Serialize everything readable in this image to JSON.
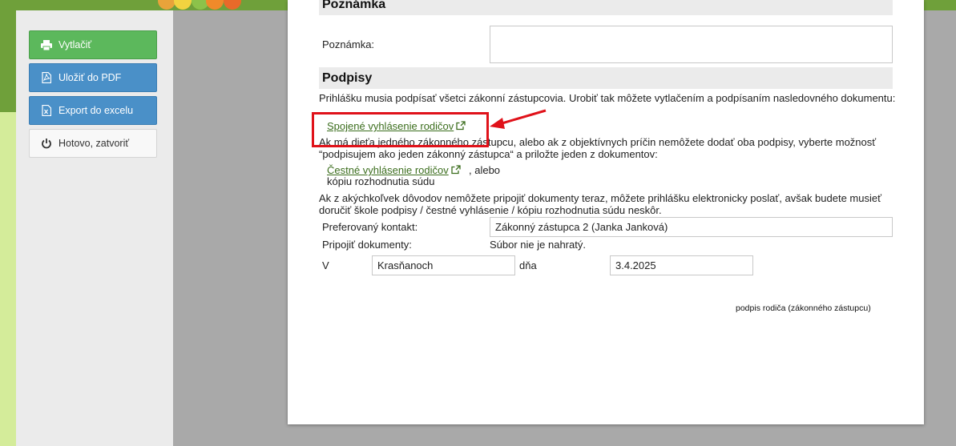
{
  "sidebar": {
    "print_label": "Vytlačiť",
    "pdf_label": "Uložiť do PDF",
    "excel_label": "Export do excelu",
    "done_label": "Hotovo, zatvoriť"
  },
  "note_section": {
    "heading": "Poznámka",
    "label": "Poznámka:",
    "value": ""
  },
  "signatures": {
    "heading": "Podpisy",
    "intro": "Prihlášku musia podpísať všetci zákonní zástupcovia. Urobiť tak môžete vytlačením a podpísaním nasledovného dokumentu:",
    "joint_link": "Spojené vyhlásenie rodičov",
    "single_text": "Ak má dieťa jedného zákonného zástupcu, alebo ak z objektívnych príčin nemôžete dodať oba podpisy, vyberte možnosť “podpisujem ako jeden zákonný zástupca“ a priložte jeden z dokumentov:",
    "honor_link": "Čestné vyhlásenie rodičov",
    "or_text": ", alebo",
    "court_text": "kópiu rozhodnutia súdu",
    "later_text": "Ak z akýchkoľvek dôvodov nemôžete pripojiť dokumenty teraz, môžete prihlášku elektronicky poslať, avšak budete musieť doručiť škole podpisy / čestné vyhlásenie / kópiu rozhodnutia súdu neskôr.",
    "contact_label": "Preferovaný kontakt:",
    "contact_value": "Zákonný zástupca 2 (Janka Janková)",
    "attach_label": "Pripojiť dokumenty:",
    "attach_value": "Súbor nie je nahratý.",
    "place_prefix": "V",
    "place_value": "Krasňanoch",
    "date_prefix": "dňa",
    "date_value": "3.4.2025",
    "signature_caption": "podpis rodiča (zákonného zástupcu)"
  },
  "colors": {
    "highlight": "#e0121a",
    "link": "#3c6e1e",
    "print_button": "#5cb85c",
    "blue_button": "#4a90c8"
  }
}
